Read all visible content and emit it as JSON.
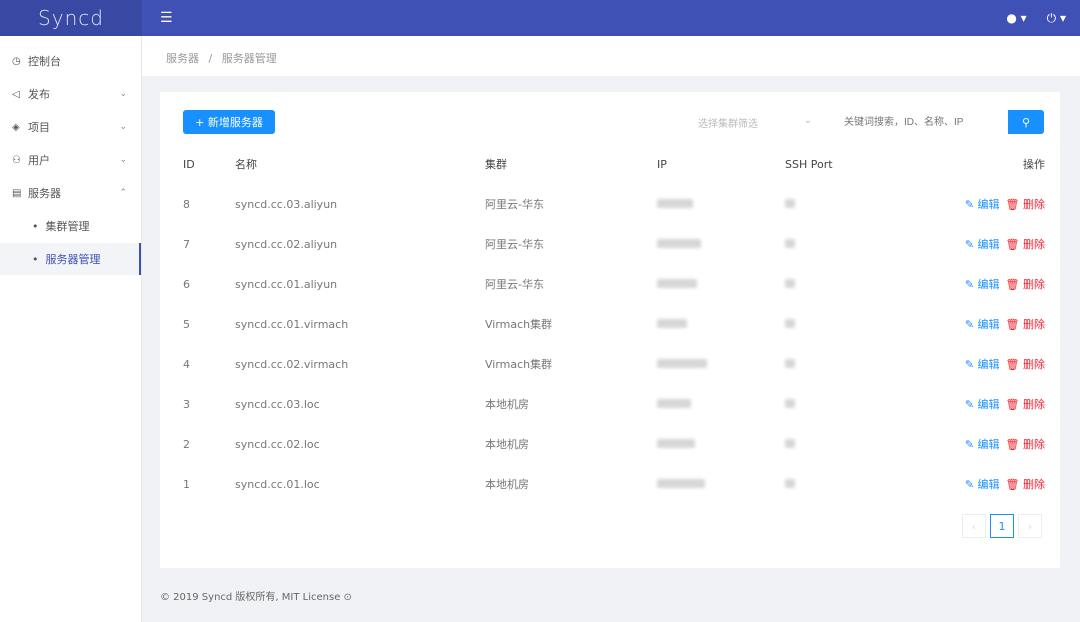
{
  "app": {
    "logo": "Syncd"
  },
  "sidebar": {
    "items": [
      {
        "label": "控制台",
        "icon": "dashboard-icon",
        "glyph": "◷",
        "arrow": ""
      },
      {
        "label": "发布",
        "icon": "send-icon",
        "glyph": "◁",
        "arrow": "⌄"
      },
      {
        "label": "项目",
        "icon": "layers-icon",
        "glyph": "◈",
        "arrow": "⌄"
      },
      {
        "label": "用户",
        "icon": "users-icon",
        "glyph": "⚇",
        "arrow": "⌄"
      },
      {
        "label": "服务器",
        "icon": "server-icon",
        "glyph": "▤",
        "arrow": "⌃"
      }
    ],
    "sub": [
      "集群管理",
      "服务器管理"
    ]
  },
  "breadcrumb": {
    "root": "服务器",
    "sep": "/",
    "current": "服务器管理"
  },
  "toolbar": {
    "add": "+ 新增服务器",
    "select_placeholder": "选择集群筛选",
    "search_placeholder": "关键词搜索，ID、名称、IP"
  },
  "table": {
    "headers": [
      "ID",
      "名称",
      "集群",
      "IP",
      "SSH Port",
      "操作"
    ],
    "edit": "✎ 编辑",
    "delete": "🗑 删除",
    "rows": [
      {
        "id": "8",
        "name": "syncd.cc.03.aliyun",
        "cluster": "阿里云-华东"
      },
      {
        "id": "7",
        "name": "syncd.cc.02.aliyun",
        "cluster": "阿里云-华东"
      },
      {
        "id": "6",
        "name": "syncd.cc.01.aliyun",
        "cluster": "阿里云-华东"
      },
      {
        "id": "5",
        "name": "syncd.cc.01.virmach",
        "cluster": "Virmach集群"
      },
      {
        "id": "4",
        "name": "syncd.cc.02.virmach",
        "cluster": "Virmach集群"
      },
      {
        "id": "3",
        "name": "syncd.cc.03.loc",
        "cluster": "本地机房"
      },
      {
        "id": "2",
        "name": "syncd.cc.02.loc",
        "cluster": "本地机房"
      },
      {
        "id": "1",
        "name": "syncd.cc.01.loc",
        "cluster": "本地机房"
      }
    ]
  },
  "pagination": {
    "prev": "‹",
    "current": "1",
    "next": "›"
  },
  "footer": "© 2019 Syncd 版权所有, MIT License"
}
